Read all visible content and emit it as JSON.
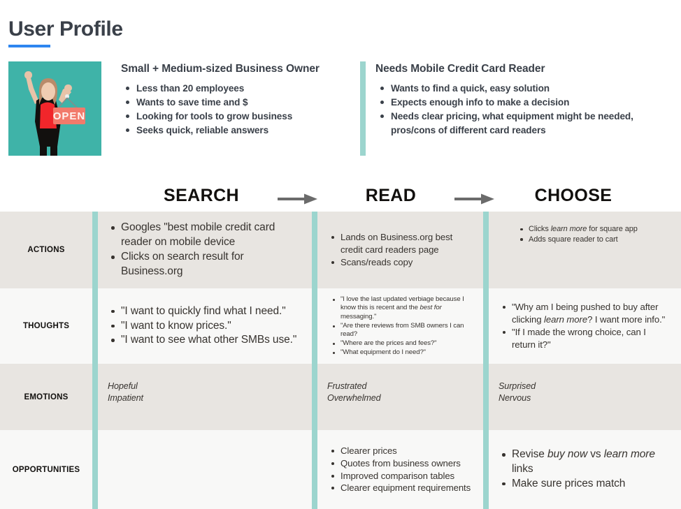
{
  "title": "User Profile",
  "accent_colors": {
    "title_underline": "#2E86F0",
    "teal_divider": "#9CD5CE",
    "persona_bg": "#3FB3A8",
    "row_shaded": "#E8E5E1",
    "row_plain": "#F8F8F7",
    "text": "#3A4049"
  },
  "persona": {
    "image_alt": "woman-with-open-sign-illustration",
    "columns": [
      {
        "heading": "Small + Medium-sized Business Owner",
        "bullets": [
          "Less than 20 employees",
          "Wants to save time and $",
          "Looking for tools to grow business",
          "Seeks quick, reliable answers"
        ]
      },
      {
        "heading": "Needs Mobile Credit Card Reader",
        "bullets": [
          "Wants to find a quick, easy solution",
          "Expects enough info to make a decision",
          "Needs clear pricing, what equipment might be needed, pros/cons of different card readers"
        ]
      }
    ]
  },
  "stages": {
    "search": "SEARCH",
    "read": "READ",
    "choose": "CHOOSE",
    "arrow_icon": "arrow-right-icon"
  },
  "rows": [
    {
      "label": "ACTIONS",
      "search": [
        "Googles \"best mobile credit card reader on mobile device",
        "Clicks on search result for Business.org"
      ],
      "read": [
        "Lands on Business.org best credit card readers page",
        "Scans/reads copy"
      ],
      "choose": [
        "Clicks <em>learn more</em> for square app",
        "Adds square reader to cart"
      ]
    },
    {
      "label": "THOUGHTS",
      "search": [
        "\"I want to quickly find what I need.\"",
        "\"I want to know prices.\"",
        "\"I want to see what other SMBs use.\""
      ],
      "read": [
        "\"I love the last updated verbiage because I know this is recent and the <em>best for</em> messaging.\"",
        "\"Are there reviews from SMB owners I can read?",
        "\"Where are the prices and fees?\"",
        "\"What equipment do I need?\""
      ],
      "choose": [
        "\"Why am I being pushed to buy after clicking <em>learn more</em>? I want more info.\"",
        "\"If I made the wrong choice, can I return it?\""
      ]
    },
    {
      "label": "EMOTIONS",
      "search": [
        "Hopeful",
        "Impatient"
      ],
      "read": [
        "Frustrated",
        "Overwhelmed"
      ],
      "choose": [
        "Surprised",
        "Nervous"
      ]
    },
    {
      "label": "OPPORTUNITIES",
      "search": [],
      "read": [
        "Clearer prices",
        "Quotes from business owners",
        "Improved comparison tables",
        "Clearer equipment requirements"
      ],
      "choose": [
        "Revise <em>buy now</em> vs <em>learn more</em> links",
        "Make sure prices match"
      ]
    }
  ]
}
